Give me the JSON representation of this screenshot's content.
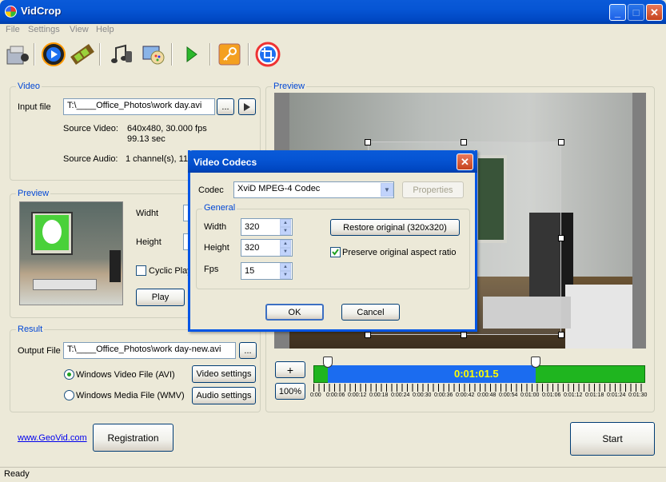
{
  "window": {
    "title": "VidCrop"
  },
  "menu": [
    "File",
    "Settings",
    "View",
    "Help"
  ],
  "toolbar": {
    "icons": [
      "movie-open-icon",
      "play-icon",
      "film-icon",
      "audio-icon",
      "effects-icon",
      "run-icon",
      "key-icon",
      "crop-icon"
    ]
  },
  "video": {
    "group_label": "Video",
    "input_label": "Input file",
    "input_value": "T:\\____Office_Photos\\work day.avi",
    "browse": "...",
    "source_video_label": "Source Video:",
    "source_video_value": "640x480, 30.000 fps",
    "duration": "99.13 sec",
    "source_audio_label": "Source Audio:",
    "source_audio_value": "1 channel(s), 11"
  },
  "preview_left": {
    "group_label": "Preview",
    "width_label": "Widht",
    "height_label": "Height",
    "cyclic_label": "Cyclic Play",
    "play": "Play"
  },
  "result": {
    "group_label": "Result",
    "output_label": "Output File",
    "output_value": "T:\\____Office_Photos\\work day-new.avi",
    "browse": "...",
    "avi_label": "Windows Video File (AVI)",
    "wmv_label": "Windows Media File (WMV)",
    "video_settings": "Video settings",
    "audio_settings": "Audio settings"
  },
  "preview_right": {
    "group_label": "Preview",
    "plus": "+",
    "zoom": "100%",
    "time": "0:01:01.5",
    "ticks": [
      "0:00",
      "0:00:06",
      "0:00:12",
      "0:00:18",
      "0:00:24",
      "0:00:30",
      "0:00:36",
      "0:00:42",
      "0:00:48",
      "0:00:54",
      "0:01:00",
      "0:01:06",
      "0:01:12",
      "0:01:18",
      "0:01:24",
      "0:01:30"
    ]
  },
  "bottom": {
    "link": "www.GeoVid.com",
    "registration": "Registration",
    "start": "Start"
  },
  "status": "Ready",
  "dialog": {
    "title": "Video Codecs",
    "codec_label": "Codec",
    "codec_value": "XviD MPEG-4 Codec",
    "properties": "Properties",
    "general_label": "General",
    "width_label": "Width",
    "width_value": "320",
    "height_label": "Height",
    "height_value": "320",
    "fps_label": "Fps",
    "fps_value": "15",
    "restore": "Restore original (320x320)",
    "preserve": "Preserve original aspect ratio",
    "ok": "OK",
    "cancel": "Cancel"
  },
  "colors": {
    "title_blue": "#0055e5",
    "group_label": "#0046d5",
    "timeline_green": "#1fb51f",
    "timeline_blue": "#1b6cf0",
    "time_text": "#ffff00"
  }
}
